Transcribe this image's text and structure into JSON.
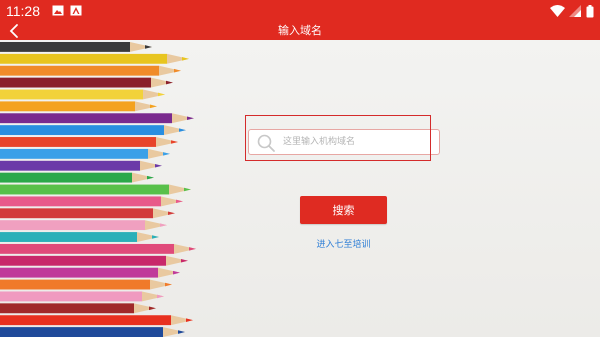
{
  "status_bar": {
    "time": "11:28",
    "notification_icons": [
      "image-icon",
      "a-icon"
    ],
    "system_icons": [
      "wifi-icon",
      "signal-icon",
      "battery-icon"
    ]
  },
  "app_bar": {
    "title": "输入域名",
    "back_icon": "chevron-left-icon",
    "background": "#e02a20"
  },
  "search": {
    "placeholder": "这里输入机构域名",
    "value": "",
    "icon": "search-icon"
  },
  "search_button": {
    "label": "搜索",
    "color": "#df2b22"
  },
  "enter_link": {
    "label": "进入七至培训",
    "color": "#2f7fd6"
  },
  "highlight_color": "#d42b2b"
}
